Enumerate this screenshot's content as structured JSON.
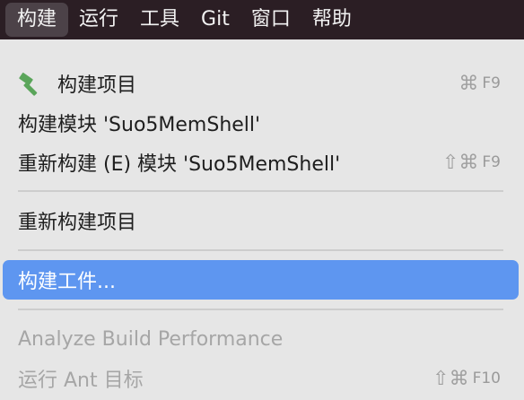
{
  "menubar": {
    "items": [
      "构建",
      "运行",
      "工具",
      "Git",
      "窗口",
      "帮助"
    ]
  },
  "menu": {
    "build_project": {
      "label": "构建项目",
      "shortcut_mod": "⌘",
      "shortcut_key": "F9",
      "icon": "hammer-icon"
    },
    "build_module": {
      "label": "构建模块 'Suo5MemShell'"
    },
    "rebuild_module": {
      "label": "重新构建 (E) 模块 'Suo5MemShell'",
      "shortcut_mod": "⇧⌘",
      "shortcut_key": "F9"
    },
    "rebuild_project": {
      "label": "重新构建项目"
    },
    "build_artifacts": {
      "label": "构建工件..."
    },
    "analyze_build": {
      "label": "Analyze Build Performance"
    },
    "run_ant": {
      "label": "运行 Ant 目标",
      "shortcut_mod": "⇧⌘",
      "shortcut_key": "F10"
    }
  },
  "colors": {
    "menubar_bg": "#2b1e24",
    "menu_bg": "#e6e6e6",
    "highlight": "#5e96f0",
    "icon_green": "#5aa55a"
  }
}
